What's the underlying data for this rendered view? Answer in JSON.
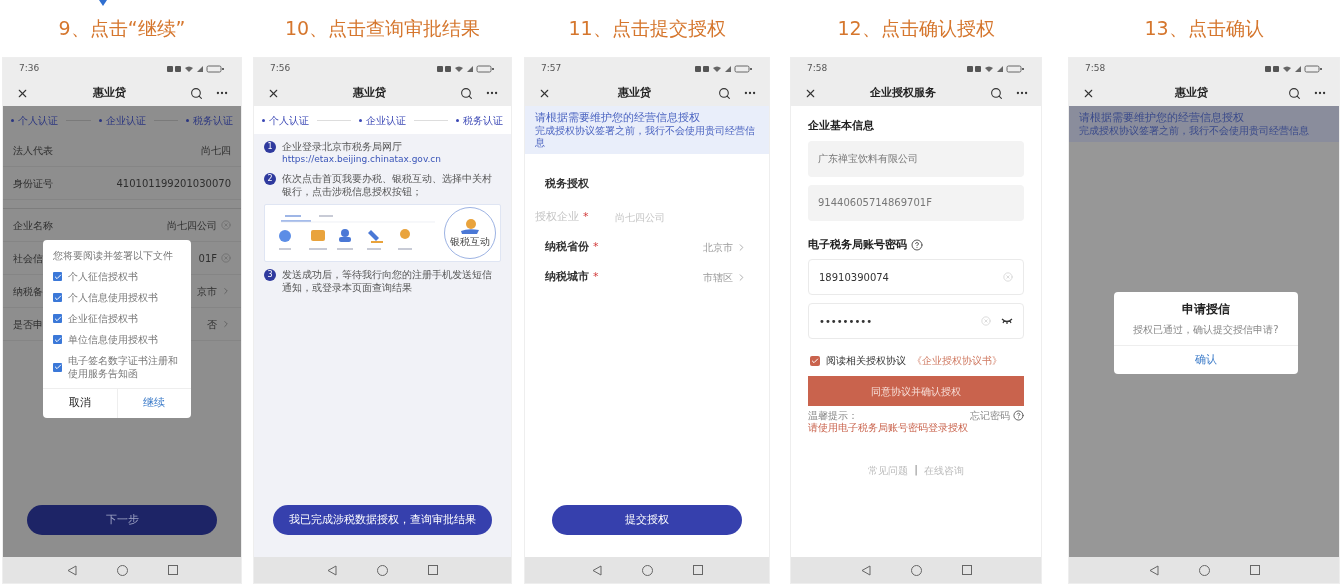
{
  "screens": [
    {
      "kind": "sign",
      "caption": "9、点击“继续”",
      "time": "7:36",
      "title": "惠业贷",
      "dimmed": true,
      "steps": [
        {
          "label": "个人认证"
        },
        {
          "label": "企业认证"
        },
        {
          "label": "税务认证"
        }
      ],
      "row_groups": [
        [
          {
            "label": "法人代表",
            "value": "尚七四",
            "kind": "text"
          },
          {
            "label": "身份证号",
            "value": "410101199201030070",
            "kind": "text"
          }
        ],
        [
          {
            "label": "企业名称",
            "value": "尚七四公司",
            "kind": "clear"
          },
          {
            "label": "社会信",
            "value": "01F",
            "kind": "clear"
          },
          {
            "label": "纳税备",
            "value": "京市",
            "kind": "arrow"
          },
          {
            "label": "是否申",
            "value": "否",
            "kind": "arrow"
          }
        ]
      ],
      "dialog": {
        "message": "您将要阅读并签署以下文件",
        "items": [
          {
            "label": "个人征信授权书",
            "checked": true
          },
          {
            "label": "个人信息使用授权书",
            "checked": true
          },
          {
            "label": "企业征信授权书",
            "checked": true
          },
          {
            "label": "单位信息使用授权书",
            "checked": true
          },
          {
            "label": "电子签名数字证书注册和使用服务告知函",
            "checked": true
          }
        ],
        "buttons": [
          {
            "label": "取消",
            "kind": "cancel"
          },
          {
            "label": "继续",
            "kind": "confirm"
          }
        ]
      },
      "primary_button": "下一步"
    },
    {
      "kind": "guide",
      "caption": "10、点击查询审批结果",
      "time": "7:56",
      "title": "惠业贷",
      "dimmed": false,
      "steps": [
        {
          "label": "个人认证"
        },
        {
          "label": "企业认证"
        },
        {
          "label": "税务认证"
        }
      ],
      "blocks": [
        {
          "kind": "step",
          "number": "1",
          "text": "企业登录北京市税务局网厅",
          "link": "https://etax.beijing.chinatax.gov.cn"
        },
        {
          "kind": "step",
          "number": "2",
          "text": "依次点击首页我要办税、银税互动、选择中关村银行，点击涉税信息授权按钮；"
        },
        {
          "kind": "illustration",
          "highlight": "银税互动"
        },
        {
          "kind": "step",
          "number": "3",
          "text": "发送成功后，等待我行向您的注册手机发送短信通知，或登录本页面查询结果"
        }
      ],
      "primary_button": "我已完成涉税数据授权，查询审批结果"
    },
    {
      "kind": "form",
      "caption": "11、点击提交授权",
      "time": "7:57",
      "title": "惠业贷",
      "dimmed": false,
      "banner": {
        "heading": "请根据需要维护您的经营信息授权",
        "note": "完成授权协议签署之前，我行不会使用贵司经营信息"
      },
      "section": "税务授权",
      "form_rows": [
        {
          "label": "授权企业",
          "mark": "*",
          "value": "尚七四公司",
          "kind": "text",
          "disabled": true
        },
        {
          "label": "纳税省份",
          "mark": "*",
          "value": "北京市",
          "kind": "select",
          "disabled": false
        },
        {
          "label": "纳税城市",
          "mark": "*",
          "value": "市辖区",
          "kind": "select",
          "disabled": false
        }
      ],
      "primary_button": "提交授权"
    },
    {
      "kind": "auth",
      "caption": "12、点击确认授权",
      "time": "7:58",
      "title": "企业授权服务",
      "dimmed": false,
      "company_heading": "企业基本信息",
      "company_fields": [
        {
          "value": "广东禅宝饮料有限公司"
        },
        {
          "value": "91440605714869701F"
        }
      ],
      "account_heading": "电子税务局账号密码",
      "account_fields": [
        {
          "kind": "text",
          "value": "18910390074"
        },
        {
          "kind": "password",
          "value": "•••••••••"
        }
      ],
      "agreement": {
        "checked": true,
        "text": "阅读相关授权协议",
        "link": "《企业授权协议书》"
      },
      "primary_button": "同意协议并确认授权",
      "tip": {
        "heading": "温馨提示：",
        "text": "请使用电子税务局账号密码登录授权"
      },
      "forgot": "忘记密码",
      "footer_links": [
        "常见问题",
        "在线咨询"
      ],
      "footer_separator": "|"
    },
    {
      "kind": "confirm",
      "caption": "13、点击确认",
      "time": "7:58",
      "title": "惠业贷",
      "dimmed": true,
      "banner": {
        "heading": "请根据需要维护您的经营信息授权",
        "note": "完成授权协议签署之前，我行不会使用贵司经营信息"
      },
      "dialog": {
        "heading": "申请授信",
        "message": "授权已通过，确认提交授信申请?",
        "buttons": [
          {
            "label": "确认",
            "kind": "confirm"
          }
        ]
      }
    }
  ]
}
